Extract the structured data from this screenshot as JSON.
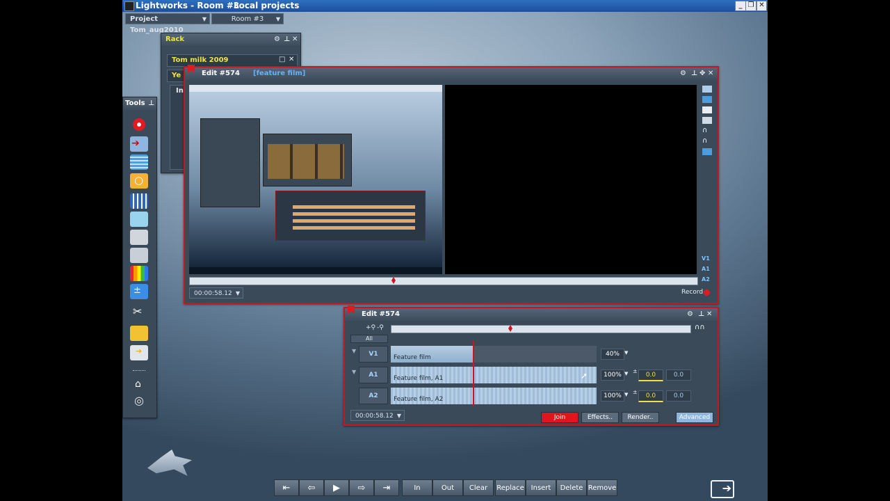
{
  "window": {
    "title": "Lightworks - Room #3",
    "subtitle": "Local projects"
  },
  "project_bar": {
    "project": "Project Tom_aug2010",
    "room": "Room #3"
  },
  "rack": {
    "title": "Rack",
    "items": [
      "Tom milk 2009",
      "Ye",
      "In"
    ]
  },
  "tools": {
    "title": "Tools"
  },
  "viewer": {
    "title": "Edit #574",
    "subtitle": "[feature film]",
    "timecode": "00:00:58.12",
    "record_label": "Record",
    "tracks": [
      "V1",
      "A1",
      "A2"
    ]
  },
  "timeline": {
    "title": "Edit #574",
    "all_label": "All",
    "tracks": [
      {
        "label": "V1",
        "clip": "Feature film",
        "level": "40%"
      },
      {
        "label": "A1",
        "clip": "Feature film, A1",
        "level": "100%",
        "gain": "0.0",
        "pan": "0.0"
      },
      {
        "label": "A2",
        "clip": "Feature film, A2",
        "level": "100%",
        "gain": "0.0",
        "pan": "0.0"
      }
    ],
    "timecode": "00:00:58.12",
    "buttons": {
      "join": "Join",
      "effects": "Effects..",
      "render": "Render..",
      "advanced": "Advanced"
    }
  },
  "transport": {
    "in": "In",
    "out": "Out",
    "clear": "Clear",
    "replace": "Replace",
    "insert": "Insert",
    "delete": "Delete",
    "remove": "Remove"
  },
  "colors": {
    "accent_red": "#c41820",
    "title_blue": "#1f5aa8",
    "label_blue": "#a9d4ff",
    "rack_title_yellow": "#f0e24a"
  }
}
